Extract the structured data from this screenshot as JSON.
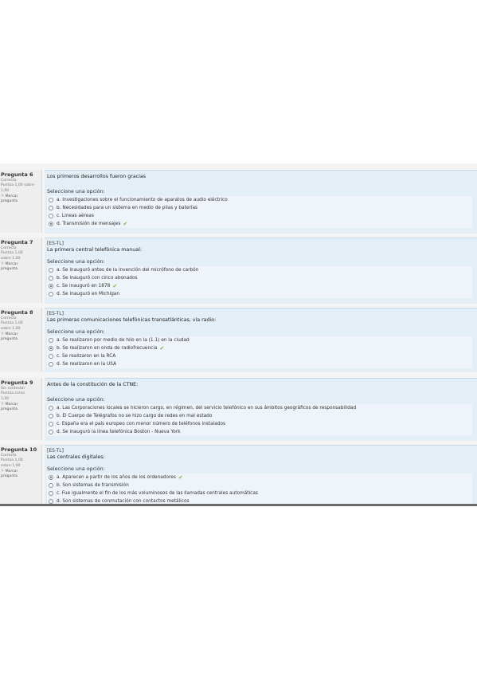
{
  "questions": [
    {
      "number": "Pregunta 6",
      "meta": [
        "Correcta",
        "Puntúa 1,00 sobre",
        "1,00"
      ],
      "flag": [
        "Marcar",
        "pregunta"
      ],
      "tag": "",
      "text": "Los primeros desarrollos fueron gracias",
      "prompt": "Seleccione una opción:",
      "options": [
        {
          "label": "a. Investigaciones sobre el funcionamiento de aparatos de audio eléctrico",
          "selected": false,
          "correct": false
        },
        {
          "label": "b. Necesidades para un sistema en medio de pilas y baterías",
          "selected": false,
          "correct": false
        },
        {
          "label": "c. Lineas aéreas",
          "selected": false,
          "correct": false
        },
        {
          "label": "d. Transmisión de mensajes",
          "selected": true,
          "correct": true
        }
      ]
    },
    {
      "number": "Pregunta 7",
      "meta": [
        "Correcta",
        "Puntúa 1,00",
        "sobre 1,00"
      ],
      "flag": [
        "Marcar",
        "pregunta"
      ],
      "tag": "[ES-TL]",
      "text": "La primera central telefónica manual:",
      "prompt": "Seleccione una opción:",
      "options": [
        {
          "label": "a. Se inauguró antes de la invención del micrófono de carbón",
          "selected": false,
          "correct": false
        },
        {
          "label": "b. Se inauguró con cinco abonados",
          "selected": false,
          "correct": false
        },
        {
          "label": "c. Se inauguró en 1878",
          "selected": true,
          "correct": true
        },
        {
          "label": "d. Se inauguró en Michigan",
          "selected": false,
          "correct": false
        }
      ]
    },
    {
      "number": "Pregunta 8",
      "meta": [
        "Correcta",
        "Puntúa 1,00",
        "sobre 1,00"
      ],
      "flag": [
        "Marcar",
        "pregunta"
      ],
      "tag": "[ES-TL]",
      "text": "Las primeras comunicaciones telefónicas transatlánticas, vía radio:",
      "prompt": "Seleccione una opción:",
      "options": [
        {
          "label": "a. Se realizaron por medio de hilo en la (1.1) en la ciudad",
          "selected": false,
          "correct": false
        },
        {
          "label": "b. Se realizaron en onda de radiofrecuencia",
          "selected": true,
          "correct": true
        },
        {
          "label": "c. Se realizaron en la RCA",
          "selected": false,
          "correct": false
        },
        {
          "label": "d. Se realizaron en la USA",
          "selected": false,
          "correct": false
        }
      ]
    },
    {
      "number": "Pregunta 9",
      "meta": [
        "Sin contestar",
        "Puntúa como",
        "1,00"
      ],
      "flag": [
        "Marcar",
        "pregunta"
      ],
      "tag": "",
      "text": "Antes de la constitución de la CTNE:",
      "prompt": "Seleccione una opción:",
      "options": [
        {
          "label": "a. Las Corporaciones locales se hicieron cargo, en régimen, del servicio telefónico en sus ámbitos geográficos de responsabilidad",
          "selected": false,
          "correct": false
        },
        {
          "label": "b. El Cuerpo de Telégrafos no se hizo cargo de redes en mal estado",
          "selected": false,
          "correct": false
        },
        {
          "label": "c. España era el país europeo con menor número de teléfonos instalados",
          "selected": false,
          "correct": false
        },
        {
          "label": "d. Se inauguró la línea telefónica Boston - Nueva York",
          "selected": false,
          "correct": false
        }
      ]
    },
    {
      "number": "Pregunta 10",
      "meta": [
        "Correcta",
        "Puntúa 1,00",
        "sobre 1,00"
      ],
      "flag": [
        "Marcar",
        "pregunta"
      ],
      "tag": "[ES-TL]",
      "text": "Las centrales digitales:",
      "prompt": "Seleccione una opción:",
      "options": [
        {
          "label": "a. Aparecen a partir de los años de los ordenadores",
          "selected": true,
          "correct": true
        },
        {
          "label": "b. Son sistemas de transmisión",
          "selected": false,
          "correct": false
        },
        {
          "label": "c. Fue igualmente el fin de los más voluminosos de las llamadas centrales automáticas",
          "selected": false,
          "correct": false
        },
        {
          "label": "d. Son sistemas de conmutación con contactos metálicos",
          "selected": false,
          "correct": false
        }
      ]
    }
  ]
}
